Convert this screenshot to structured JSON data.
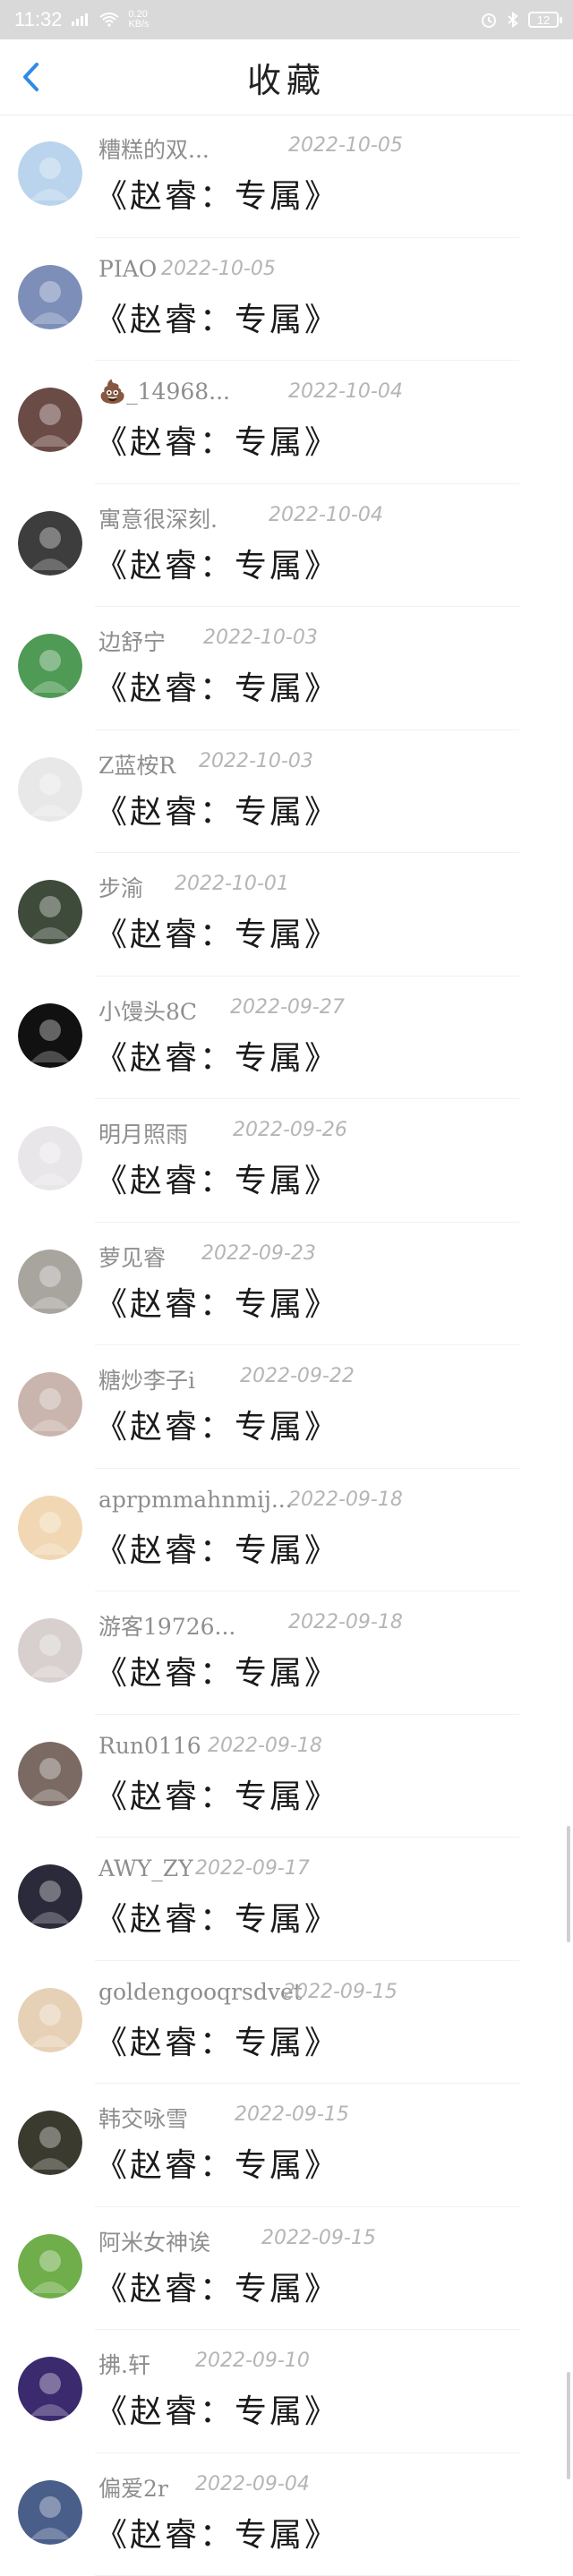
{
  "status_bar": {
    "time": "11:32",
    "network_speed": "0.20 KB/s",
    "battery": "12"
  },
  "header": {
    "title": "收藏"
  },
  "items": [
    {
      "name": "糟糕的双...",
      "date": "2022-10-05",
      "title": "《赵睿：专属》",
      "avatar_color": "#b9d4ec"
    },
    {
      "name": "PIAO",
      "date": "2022-10-05",
      "title": "《赵睿：专属》",
      "avatar_color": "#7d8fb8"
    },
    {
      "name": "💩_14968...",
      "date": "2022-10-04",
      "title": "《赵睿：专属》",
      "avatar_color": "#6b4b46"
    },
    {
      "name": "寓意很深刻.",
      "date": "2022-10-04",
      "title": "《赵睿：专属》",
      "avatar_color": "#3d3d3d"
    },
    {
      "name": "边舒宁",
      "date": "2022-10-03",
      "title": "《赵睿：专属》",
      "avatar_color": "#4f9a55"
    },
    {
      "name": "Z蓝桉R",
      "date": "2022-10-03",
      "title": "《赵睿：专属》",
      "avatar_color": "#e8e8e8"
    },
    {
      "name": "步渝",
      "date": "2022-10-01",
      "title": "《赵睿：专属》",
      "avatar_color": "#3e4a3a"
    },
    {
      "name": "小馒头8C",
      "date": "2022-09-27",
      "title": "《赵睿：专属》",
      "avatar_color": "#111111"
    },
    {
      "name": "明月照雨",
      "date": "2022-09-26",
      "title": "《赵睿：专属》",
      "avatar_color": "#e9e6ea"
    },
    {
      "name": "萝见睿",
      "date": "2022-09-23",
      "title": "《赵睿：专属》",
      "avatar_color": "#a7a59e"
    },
    {
      "name": "糖炒李子i",
      "date": "2022-09-22",
      "title": "《赵睿：专属》",
      "avatar_color": "#c9b5ad"
    },
    {
      "name": "aprpmmahnmij...",
      "date": "2022-09-18",
      "title": "《赵睿：专属》",
      "avatar_color": "#f1d7b3"
    },
    {
      "name": "游客19726...",
      "date": "2022-09-18",
      "title": "《赵睿：专属》",
      "avatar_color": "#d8cfcf"
    },
    {
      "name": "Run0116",
      "date": "2022-09-18",
      "title": "《赵睿：专属》",
      "avatar_color": "#7a6a63"
    },
    {
      "name": "AWY_ZY",
      "date": "2022-09-17",
      "title": "《赵睿：专属》",
      "avatar_color": "#2a2a3a"
    },
    {
      "name": "goldengooqrsdvet",
      "date": "2022-09-15",
      "title": "《赵睿：专属》",
      "avatar_color": "#e7d1b6"
    },
    {
      "name": "韩交咏雪",
      "date": "2022-09-15",
      "title": "《赵睿：专属》",
      "avatar_color": "#3a3a2e"
    },
    {
      "name": "阿米女神诶",
      "date": "2022-09-15",
      "title": "《赵睿：专属》",
      "avatar_color": "#6fae4a"
    },
    {
      "name": "拂.轩",
      "date": "2022-09-10",
      "title": "《赵睿：专属》",
      "avatar_color": "#3b2a6e"
    },
    {
      "name": "偏爱2r",
      "date": "2022-09-04",
      "title": "《赵睿：专属》",
      "avatar_color": "#4a5e8a"
    }
  ],
  "icons": {
    "back": "chevron-left-icon",
    "wifi": "wifi-icon",
    "signal": "signal-icon",
    "battery": "battery-icon"
  },
  "colors": {
    "accent": "#2f8be6",
    "status_bar": "#d9d9d9"
  }
}
